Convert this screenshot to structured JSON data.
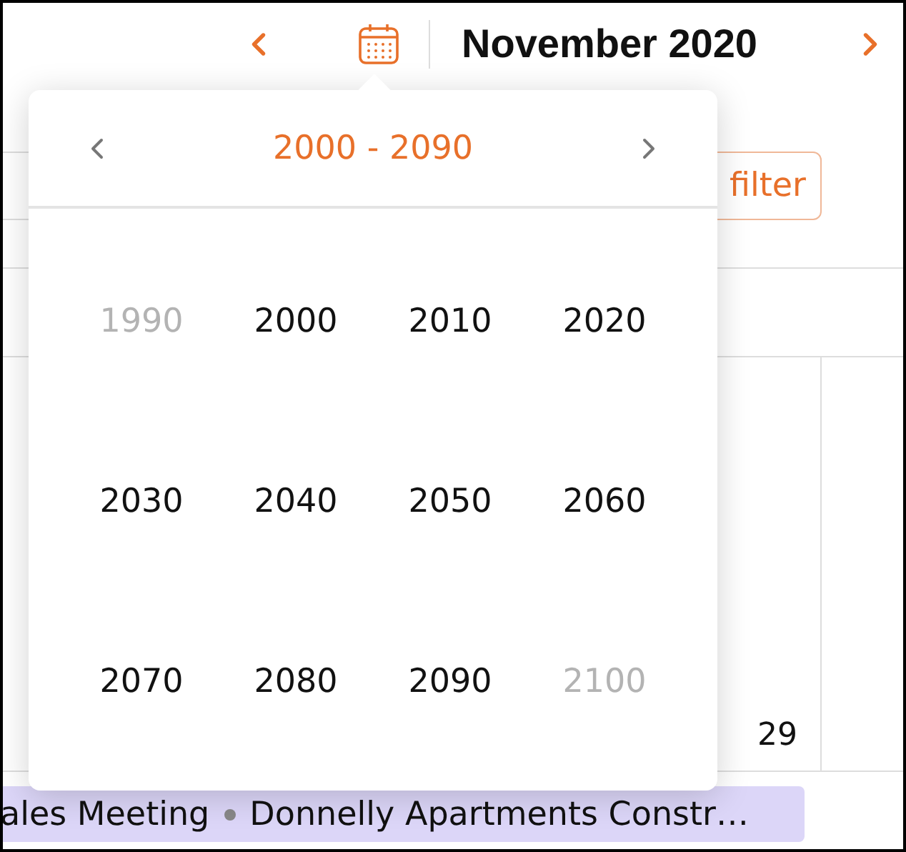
{
  "header": {
    "title": "November 2020"
  },
  "toolbar": {
    "filter_button": "filter"
  },
  "day_cell": {
    "number": "29"
  },
  "events": [
    {
      "title": "ales Meeting"
    },
    {
      "title": "Donnelly Apartments Constr…"
    }
  ],
  "year_picker": {
    "range": "2000 - 2090",
    "years": [
      {
        "label": "1990",
        "outside": true
      },
      {
        "label": "2000",
        "outside": false
      },
      {
        "label": "2010",
        "outside": false
      },
      {
        "label": "2020",
        "outside": false
      },
      {
        "label": "2030",
        "outside": false
      },
      {
        "label": "2040",
        "outside": false
      },
      {
        "label": "2050",
        "outside": false
      },
      {
        "label": "2060",
        "outside": false
      },
      {
        "label": "2070",
        "outside": false
      },
      {
        "label": "2080",
        "outside": false
      },
      {
        "label": "2090",
        "outside": false
      },
      {
        "label": "2100",
        "outside": true
      }
    ]
  }
}
